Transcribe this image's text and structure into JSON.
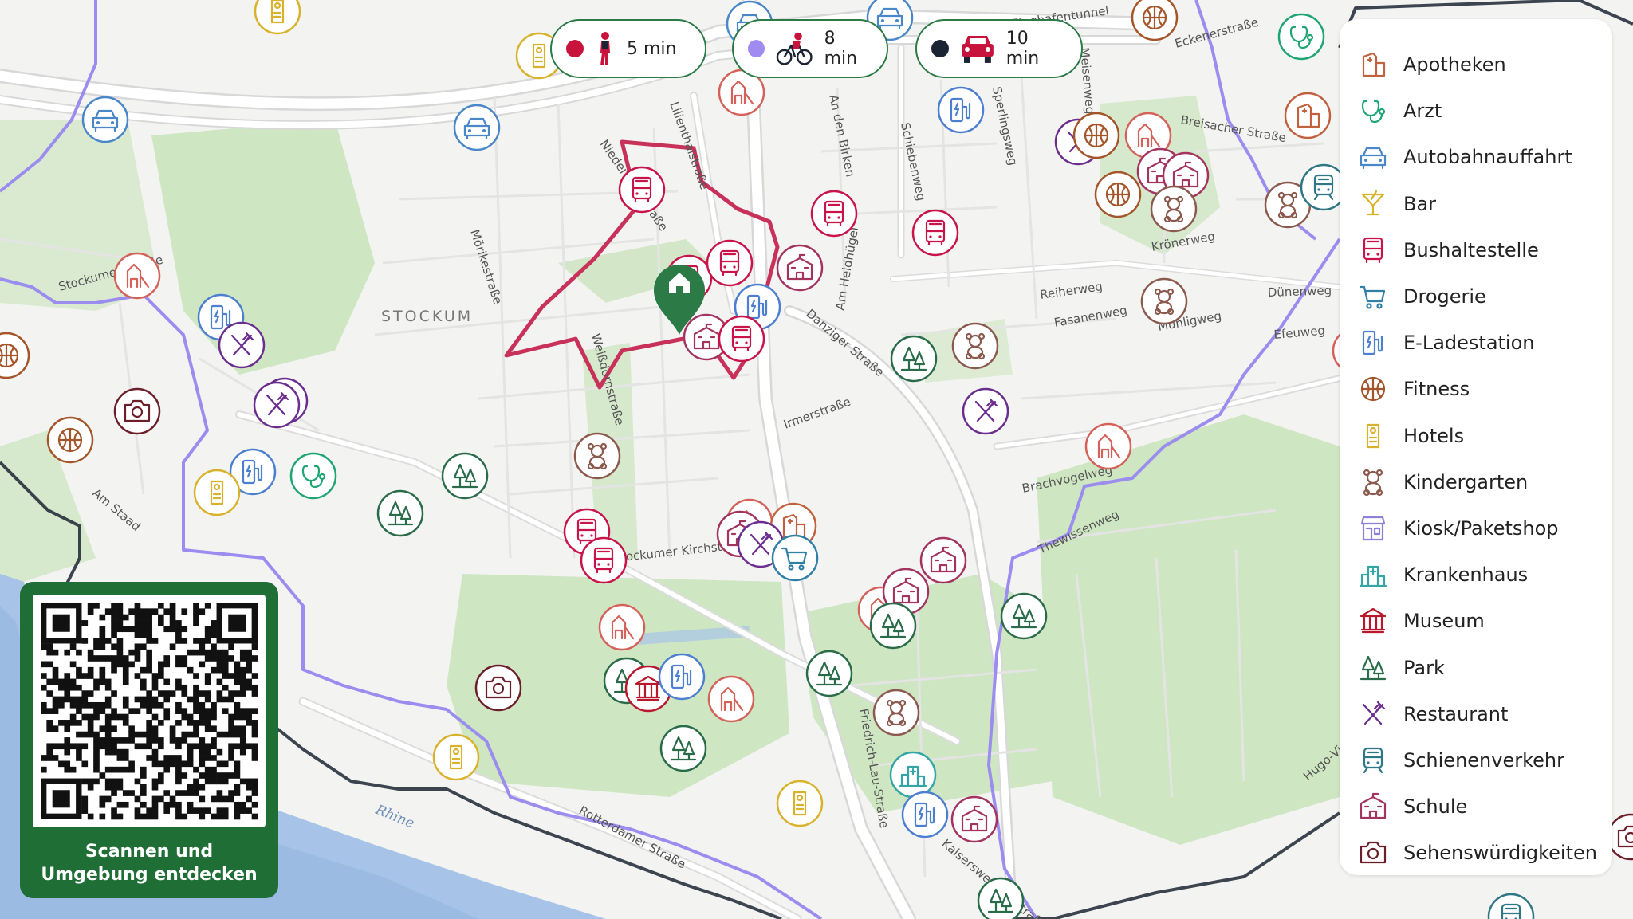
{
  "modes": [
    {
      "label": "5 min",
      "color": "#c8143c",
      "icon": "walker-icon"
    },
    {
      "label": "8 min",
      "color": "#a08cf0",
      "icon": "cyclist-icon"
    },
    {
      "label": "10 min",
      "color": "#1b2433",
      "icon": "car-icon"
    }
  ],
  "map": {
    "district": "STOCKUM",
    "river": "Rhine",
    "streets": [
      "Flughafentunnel",
      "Eckenerstraße",
      "Lilienthalstraße",
      "Niederrheinstraße",
      "An den Birken",
      "Schiebenweg",
      "Sperlingsweg",
      "Meisenweg",
      "Breisacher Straße",
      "Krönerweg",
      "Mörikestraße",
      "Stockumer Straße",
      "Am Heidhügel",
      "Danziger Straße",
      "Reiherweg",
      "Fasanenweg",
      "Mühligweg",
      "Dünenweg",
      "Efeuweg",
      "Weißdornstraße",
      "Irmerstraße",
      "Brachvogelweg",
      "Thewissenweg",
      "Stockumer Kirchstraße",
      "Am Staad",
      "Friedrich-Lau-Straße",
      "Rotterdamer Straße",
      "Kaiserswerther Straße",
      "Hugo-Viehoff-Straße"
    ]
  },
  "legend": [
    {
      "label": "Apotheken",
      "icon": "pharmacy-icon",
      "color": "#c2613e"
    },
    {
      "label": "Arzt",
      "icon": "stethoscope-icon",
      "color": "#1fa574"
    },
    {
      "label": "Autobahnauffahrt",
      "icon": "car-icon",
      "color": "#4a87c9"
    },
    {
      "label": "Bar",
      "icon": "cocktail-icon",
      "color": "#d8b32a"
    },
    {
      "label": "Bushaltestelle",
      "icon": "bus-icon",
      "color": "#c8144b"
    },
    {
      "label": "Drogerie",
      "icon": "cart-icon",
      "color": "#2f7fa6"
    },
    {
      "label": "E-Ladestation",
      "icon": "charging-station-icon",
      "color": "#4c7fd0"
    },
    {
      "label": "Fitness",
      "icon": "basketball-icon",
      "color": "#a4552a"
    },
    {
      "label": "Hotels",
      "icon": "door-hanger-icon",
      "color": "#d9b22c"
    },
    {
      "label": "Kindergarten",
      "icon": "teddy-bear-icon",
      "color": "#8b5a4e"
    },
    {
      "label": "Kiosk/Paketshop",
      "icon": "shop-icon",
      "color": "#8f7fd6"
    },
    {
      "label": "Krankenhaus",
      "icon": "hospital-icon",
      "color": "#34a5a5"
    },
    {
      "label": "Museum",
      "icon": "museum-icon",
      "color": "#b8182c"
    },
    {
      "label": "Park",
      "icon": "trees-icon",
      "color": "#2a6b4a"
    },
    {
      "label": "Restaurant",
      "icon": "cutlery-icon",
      "color": "#6b2d8e"
    },
    {
      "label": "Schienenverkehr",
      "icon": "train-icon",
      "color": "#2e7785"
    },
    {
      "label": "Schule",
      "icon": "school-icon",
      "color": "#a3345f"
    },
    {
      "label": "Sehenswürdigkeiten",
      "icon": "camera-icon",
      "color": "#6b1f2b"
    }
  ],
  "qr": {
    "caption_line1": "Scannen und",
    "caption_line2": "Umgebung entdecken"
  },
  "home": {
    "icon": "home-pin-icon",
    "color": "#2c7a45"
  }
}
